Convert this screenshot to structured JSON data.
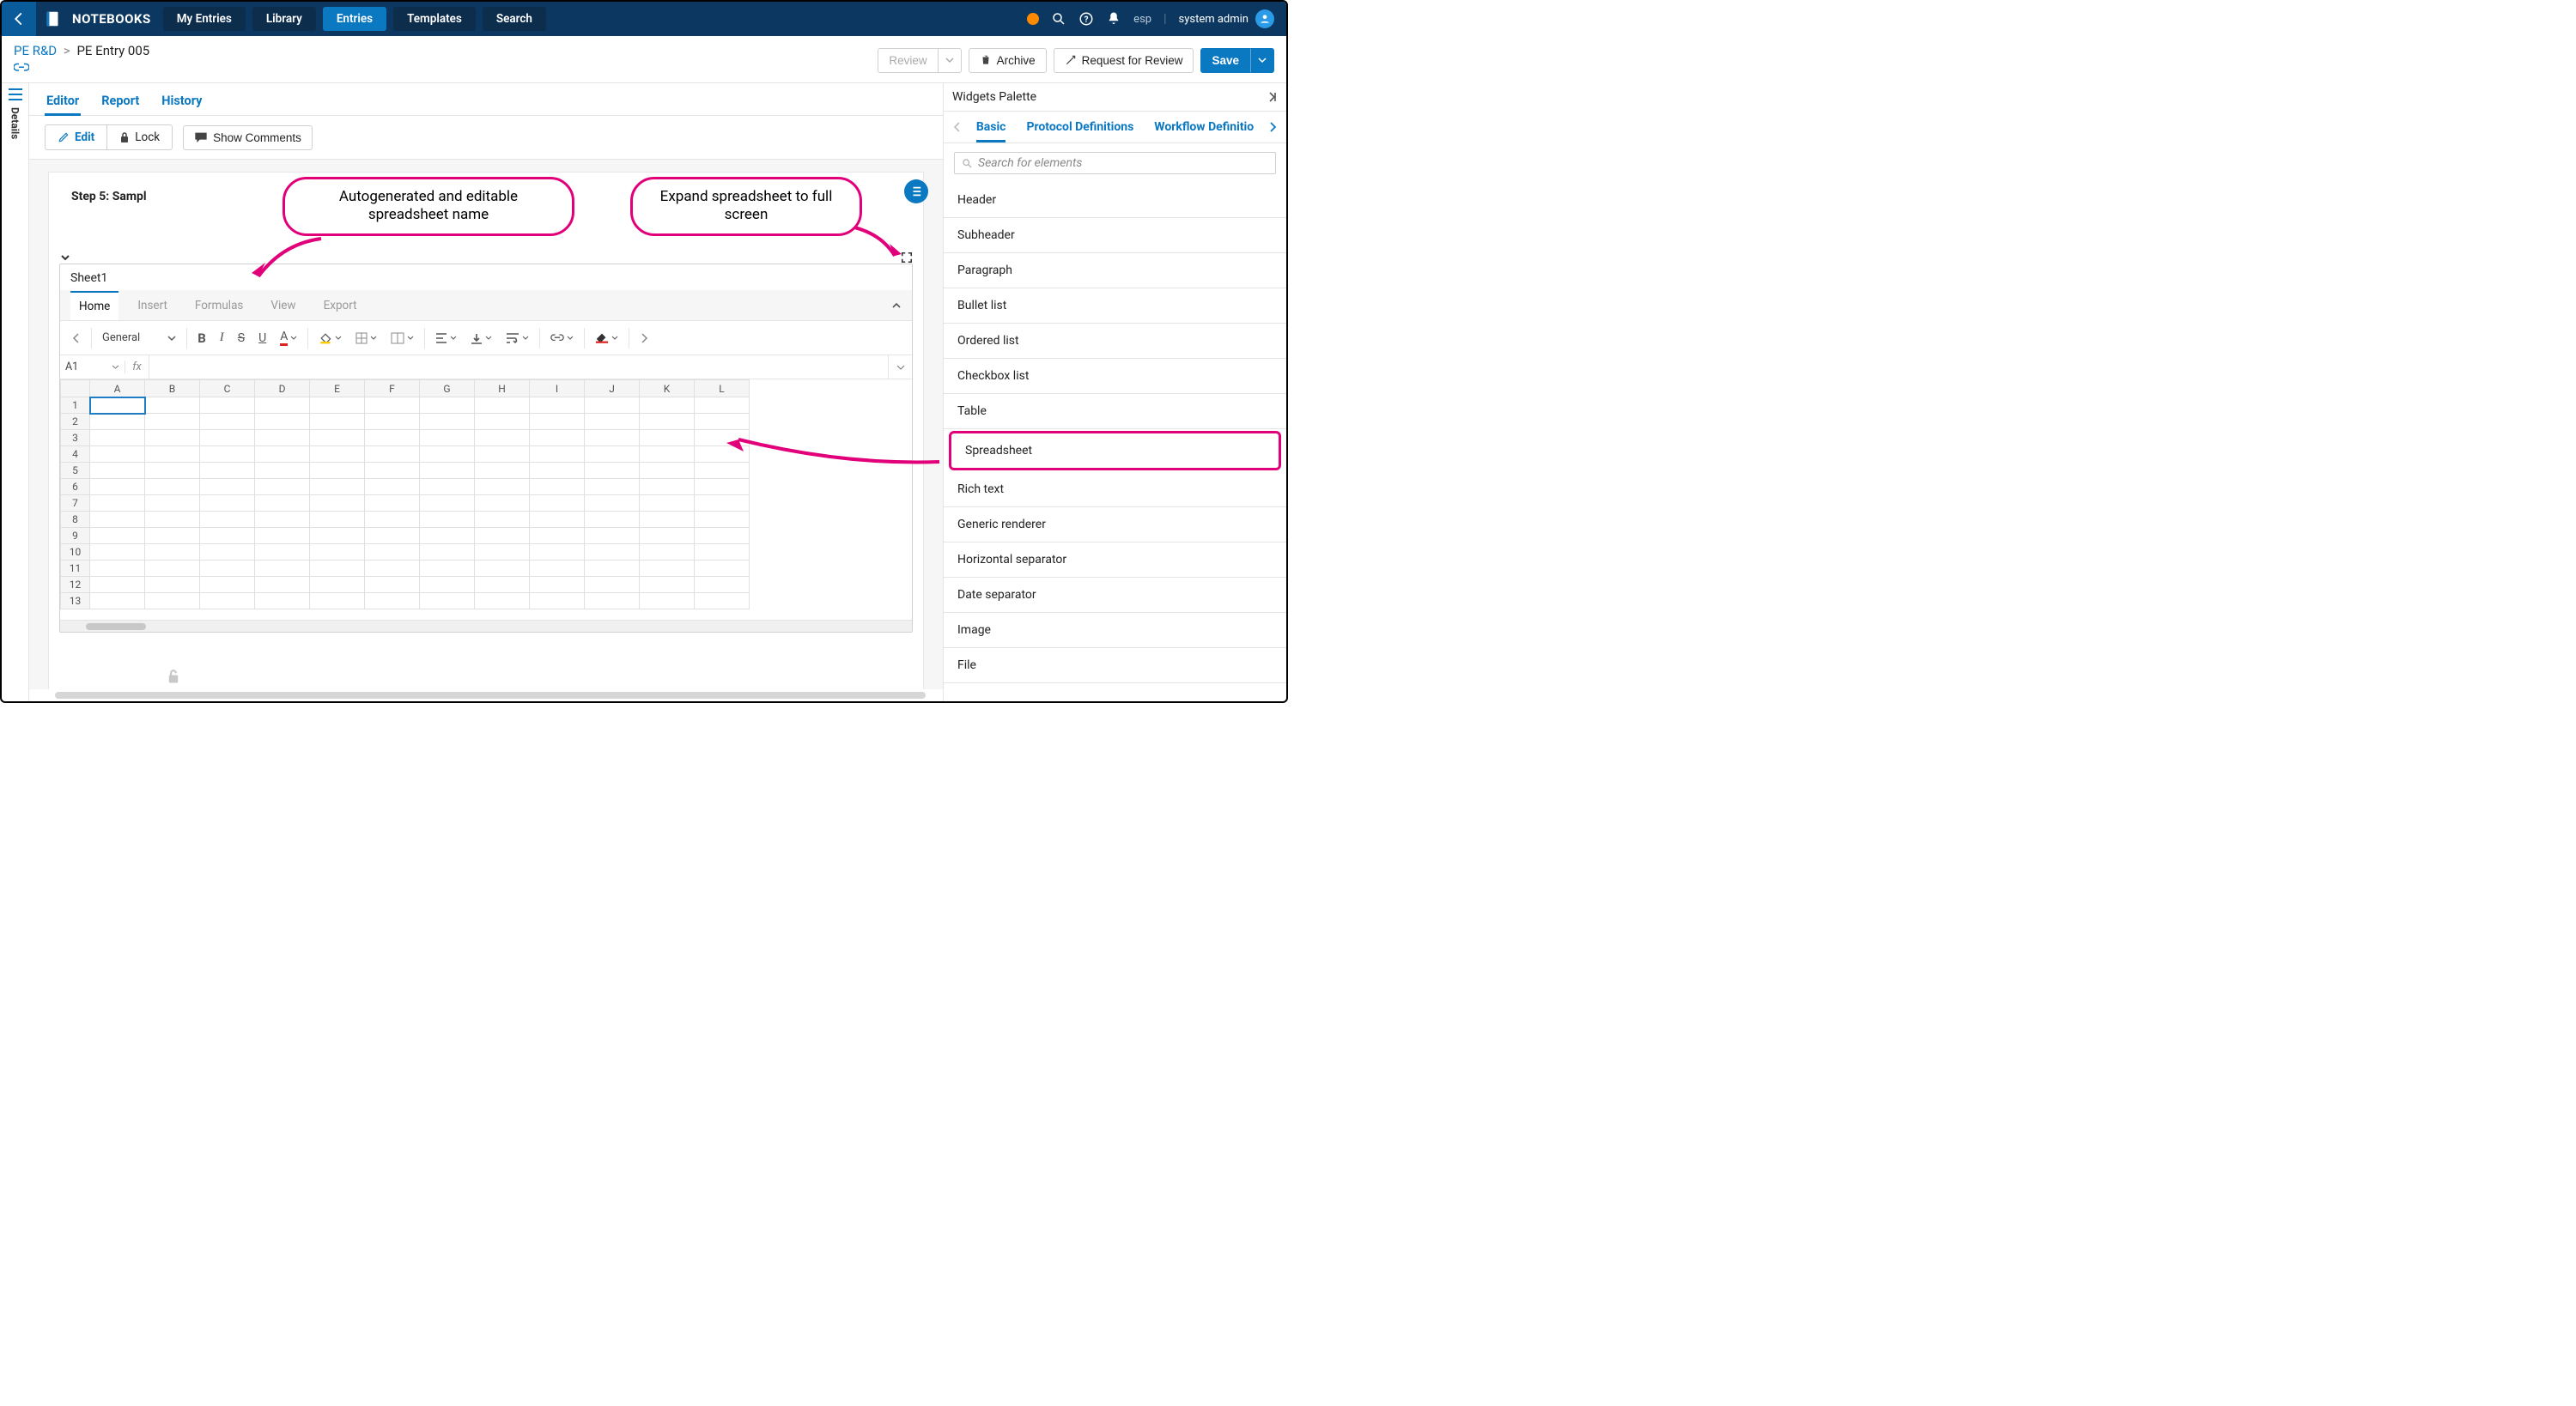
{
  "topnav": {
    "app_title": "NOTEBOOKS",
    "items": [
      "My Entries",
      "Library",
      "Entries",
      "Templates",
      "Search"
    ],
    "active_index": 2,
    "app_label": "esp",
    "user_name": "system admin"
  },
  "breadcrumb": {
    "parent": "PE R&D",
    "current": "PE Entry 005"
  },
  "actions": {
    "review": "Review",
    "archive": "Archive",
    "request_review": "Request for Review",
    "save": "Save"
  },
  "details_rail": "Details",
  "tabs": {
    "items": [
      "Editor",
      "Report",
      "History"
    ],
    "active_index": 0
  },
  "toolbar": {
    "edit": "Edit",
    "lock": "Lock",
    "show_comments": "Show Comments"
  },
  "document": {
    "step_title": "Step 5: Sampl",
    "sheet_name": "Sheet1",
    "sheet_tabs": [
      "Home",
      "Insert",
      "Formulas",
      "View",
      "Export"
    ],
    "sheet_tab_active": 0,
    "number_format": "General",
    "cell_ref": "A1",
    "fx_label": "fx",
    "columns": [
      "A",
      "B",
      "C",
      "D",
      "E",
      "F",
      "G",
      "H",
      "I",
      "J",
      "K",
      "L"
    ],
    "rows": [
      "1",
      "2",
      "3",
      "4",
      "5",
      "6",
      "7",
      "8",
      "9",
      "10",
      "11",
      "12",
      "13"
    ]
  },
  "palette": {
    "title": "Widgets Palette",
    "tabs": [
      "Basic",
      "Protocol Definitions",
      "Workflow Definitio"
    ],
    "active_tab": 0,
    "search_placeholder": "Search for elements",
    "items": [
      "Header",
      "Subheader",
      "Paragraph",
      "Bullet list",
      "Ordered list",
      "Checkbox list",
      "Table",
      "Spreadsheet",
      "Rich text",
      "Generic renderer",
      "Horizontal separator",
      "Date separator",
      "Image",
      "File"
    ],
    "highlight_index": 7
  },
  "callouts": {
    "name": "Autogenerated and editable spreadsheet name",
    "expand": "Expand spreadsheet to full screen"
  },
  "colors": {
    "highlight": "#e2007a",
    "primary": "#0b78c2",
    "navbg": "#0b3760"
  }
}
